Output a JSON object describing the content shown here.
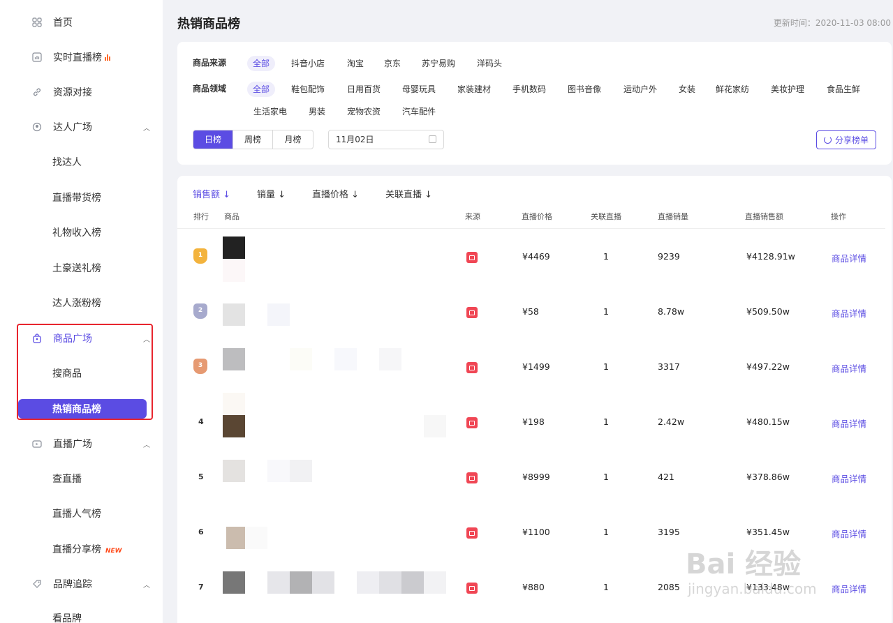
{
  "sidebar": {
    "items": [
      {
        "label": "首页",
        "icon": "grid-icon"
      },
      {
        "label": "实时直播榜",
        "icon": "chart-icon"
      },
      {
        "label": "资源对接",
        "icon": "link-icon"
      },
      {
        "label": "达人广场",
        "icon": "user-icon"
      },
      {
        "label": "商品广场",
        "icon": "bag-icon"
      },
      {
        "label": "直播广场",
        "icon": "tv-icon"
      },
      {
        "label": "品牌追踪",
        "icon": "tag-icon"
      }
    ],
    "sub": {
      "talent": [
        "找达人",
        "直播带货榜",
        "礼物收入榜",
        "土豪送礼榜",
        "达人涨粉榜"
      ],
      "goods": [
        "搜商品",
        "热销商品榜"
      ],
      "live": [
        "查直播",
        "直播人气榜",
        "直播分享榜"
      ],
      "brand": [
        "看品牌"
      ]
    },
    "new_badge": "NEW",
    "active_color": "#5b4ce3"
  },
  "page": {
    "title": "热销商品榜",
    "update_time": "更新时间：2020-11-03 08:00"
  },
  "filters": {
    "source_label": "商品来源",
    "sources": [
      "全部",
      "抖音小店",
      "淘宝",
      "京东",
      "苏宁易购",
      "洋码头"
    ],
    "domain_label": "商品领域",
    "domains_row1": [
      "全部",
      "鞋包配饰",
      "日用百货",
      "母婴玩具",
      "家装建材",
      "手机数码",
      "图书音像",
      "运动户外",
      "女装",
      "鲜花家纺",
      "美妆护理",
      "食品生鲜"
    ],
    "domains_row2": [
      "生活家电",
      "男装",
      "宠物农资",
      "汽车配件"
    ],
    "periods": [
      "日榜",
      "周榜",
      "月榜"
    ],
    "date": "11月02日",
    "share": "分享榜单"
  },
  "table": {
    "sort_tabs": [
      "销售额 ↓",
      "销量 ↓",
      "直播价格 ↓",
      "关联直播 ↓"
    ],
    "headers": [
      "排行",
      "商品",
      "来源",
      "直播价格",
      "关联直播",
      "直播销量",
      "直播销售额",
      "操作"
    ],
    "detail_label": "商品详情",
    "rows": [
      {
        "rank": "1",
        "price": "¥4469",
        "lives": "1",
        "volume": "9239",
        "sales": "¥4128.91w"
      },
      {
        "rank": "2",
        "price": "¥58",
        "lives": "1",
        "volume": "8.78w",
        "sales": "¥509.50w"
      },
      {
        "rank": "3",
        "price": "¥1499",
        "lives": "1",
        "volume": "3317",
        "sales": "¥497.22w"
      },
      {
        "rank": "4",
        "price": "¥198",
        "lives": "1",
        "volume": "2.42w",
        "sales": "¥480.15w"
      },
      {
        "rank": "5",
        "price": "¥8999",
        "lives": "1",
        "volume": "421",
        "sales": "¥378.86w"
      },
      {
        "rank": "6",
        "price": "¥1100",
        "lives": "1",
        "volume": "3195",
        "sales": "¥351.45w"
      },
      {
        "rank": "7",
        "price": "¥880",
        "lives": "1",
        "volume": "2085",
        "sales": "¥133.48w"
      }
    ]
  },
  "watermark": {
    "main": "Bai 经验",
    "sub": "jingyan.baidu.com"
  }
}
